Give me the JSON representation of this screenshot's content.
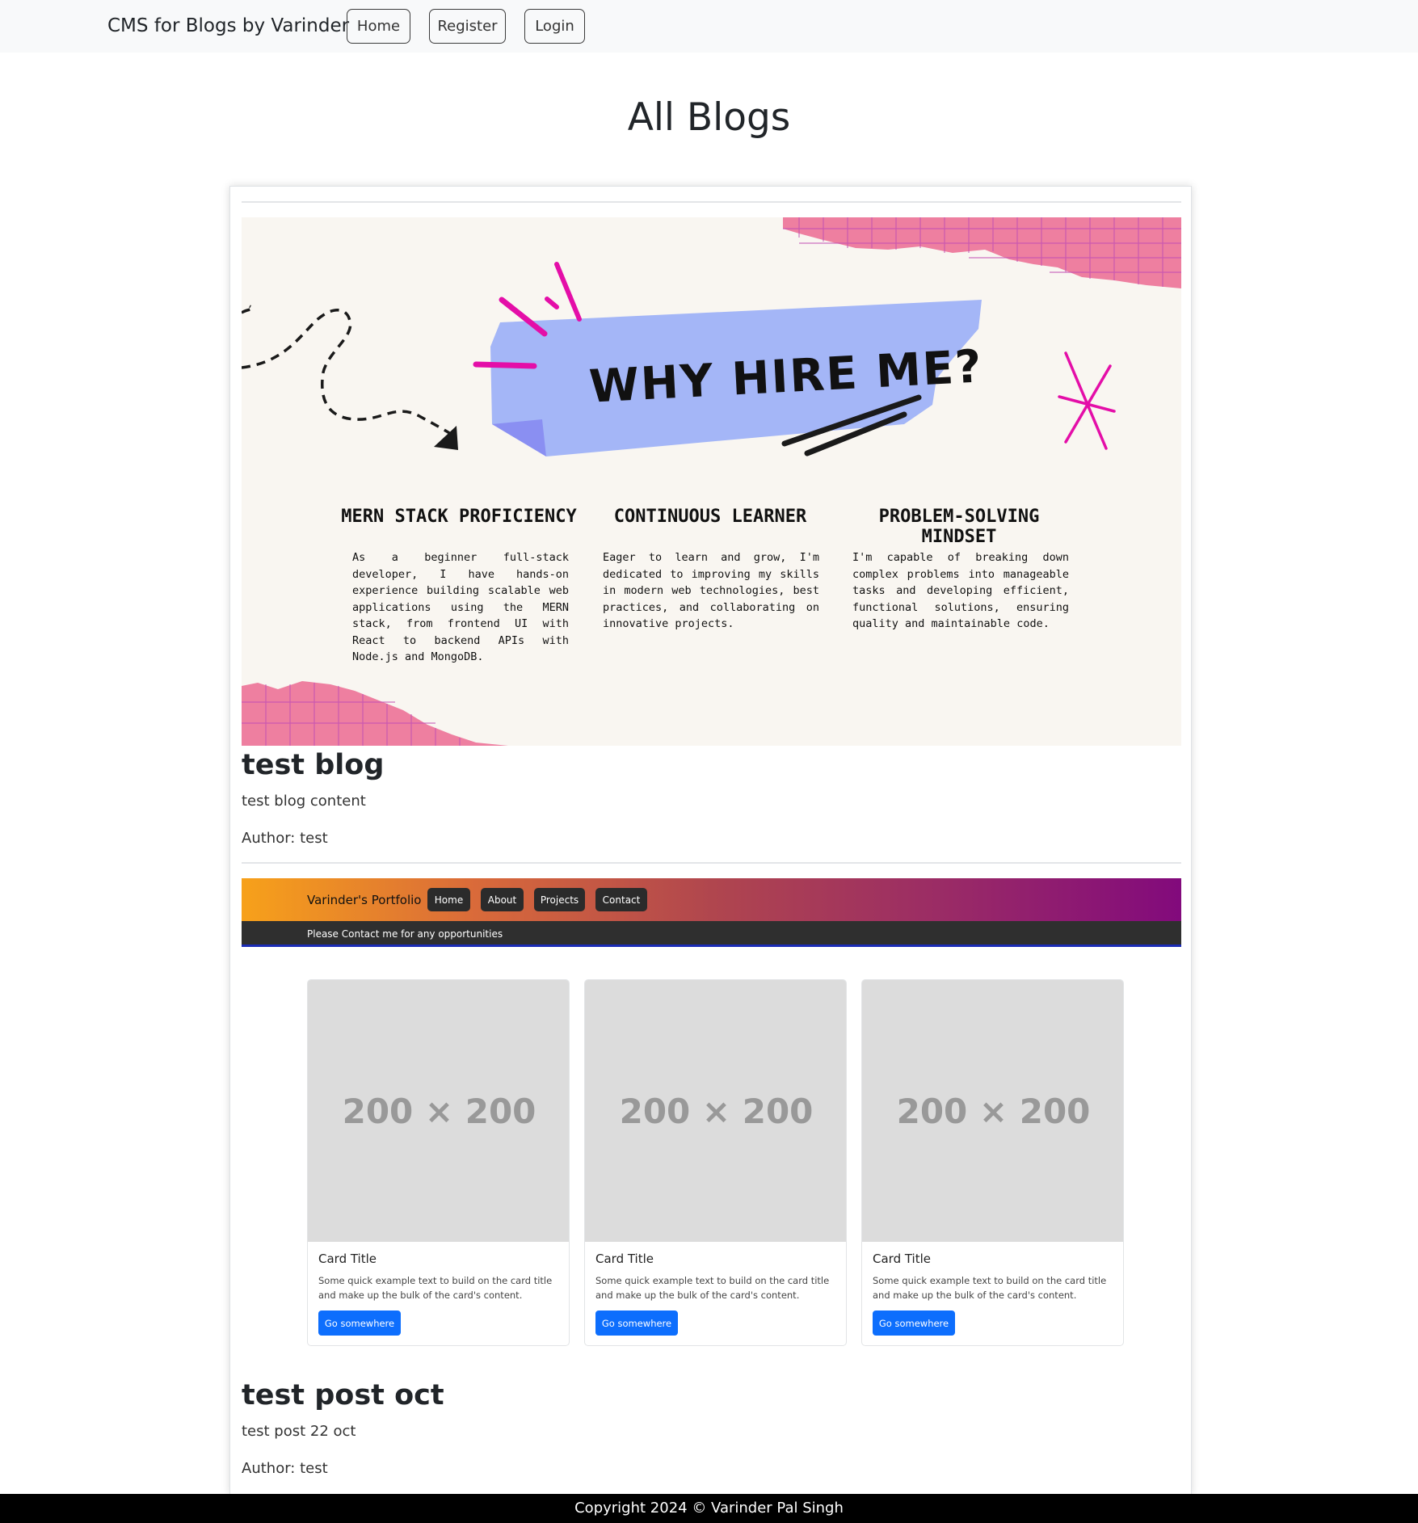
{
  "navbar": {
    "brand": "CMS for Blogs by Varinder",
    "home": "Home",
    "register": "Register",
    "login": "Login"
  },
  "page_title": "All Blogs",
  "blogs": [
    {
      "image": {
        "heading": "WHY HIRE ME?",
        "columns": [
          {
            "title": "MERN STACK PROFICIENCY",
            "text": "As a beginner full-stack developer, I have hands-on experience building scalable web applications using the MERN stack, from frontend UI with React to backend APIs with Node.js and MongoDB."
          },
          {
            "title": "CONTINUOUS LEARNER",
            "text": "Eager to learn and grow, I'm dedicated to improving my skills in modern web technologies, best practices, and collaborating on innovative projects."
          },
          {
            "title": "PROBLEM-SOLVING MINDSET",
            "text": "I'm capable of breaking down complex problems into manageable tasks and developing efficient, functional solutions, ensuring quality and maintainable code."
          }
        ]
      },
      "title": "test blog",
      "content": "test blog content",
      "author": "Author: test"
    },
    {
      "image": {
        "brand": "Varinder's Portfolio",
        "nav": [
          "Home",
          "About",
          "Projects",
          "Contact"
        ],
        "banner": "Please Contact me for any opportunities",
        "cards": [
          {
            "placeholder": "200 × 200",
            "title": "Card Title",
            "text": "Some quick example text to build on the card title and make up the bulk of the card's content.",
            "button": "Go somewhere"
          },
          {
            "placeholder": "200 × 200",
            "title": "Card Title",
            "text": "Some quick example text to build on the card title and make up the bulk of the card's content.",
            "button": "Go somewhere"
          },
          {
            "placeholder": "200 × 200",
            "title": "Card Title",
            "text": "Some quick example text to build on the card title and make up the bulk of the card's content.",
            "button": "Go somewhere"
          }
        ]
      },
      "title": "test post oct",
      "content": "test post 22 oct",
      "author": "Author: test"
    }
  ],
  "footer": "Copyright 2024 © Varinder Pal Singh",
  "colors": {
    "navbar_bg": "#f8f9fa",
    "poster_pink": "#ee7fa0",
    "poster_blue": "#a4b6f7",
    "poster_magenta": "#e40ea8",
    "portfolio_gradient_start": "#f7a11a",
    "portfolio_gradient_end": "#820a7c",
    "card_button": "#0d6efd",
    "footer_bg": "#000000"
  }
}
